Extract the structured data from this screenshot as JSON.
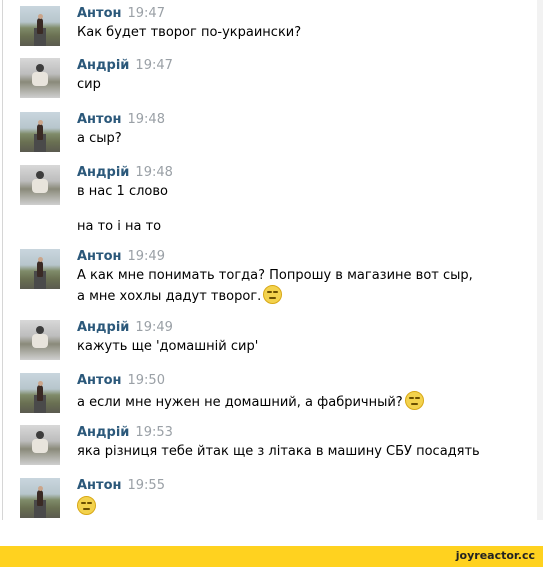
{
  "messages": [
    {
      "author": "Антон",
      "time": "19:47",
      "lines": [
        "Как будет творог по-украински?"
      ]
    },
    {
      "author": "Андрій",
      "time": "19:47",
      "lines": [
        "сир"
      ]
    },
    {
      "author": "Антон",
      "time": "19:48",
      "lines": [
        "а сыр?"
      ]
    },
    {
      "author": "Андрій",
      "time": "19:48",
      "lines": [
        "в нас 1 слово",
        "на то і на то"
      ]
    },
    {
      "author": "Антон",
      "time": "19:49",
      "lines": [
        "А как мне понимать тогда? Попрошу в магазине вот сыр,",
        "а мне хохлы дадут творог."
      ]
    },
    {
      "author": "Андрій",
      "time": "19:49",
      "lines": [
        "кажуть ще 'домашній сир'"
      ]
    },
    {
      "author": "Антон",
      "time": "19:50",
      "lines": [
        "а если мне нужен не домашний, а фабричный?"
      ]
    },
    {
      "author": "Андрій",
      "time": "19:53",
      "lines": [
        "яка різниця тебе йтак ще з літака в машину СБУ посадять"
      ]
    },
    {
      "author": "Антон",
      "time": "19:55",
      "lines": [
        ""
      ]
    }
  ],
  "icons": {
    "emoji": "smiley-icon"
  },
  "colors": {
    "author": "#2b587a",
    "time": "#9aa0a6",
    "footer": "#ffd21f"
  },
  "footer": {
    "text": "joyreactor.cc"
  }
}
